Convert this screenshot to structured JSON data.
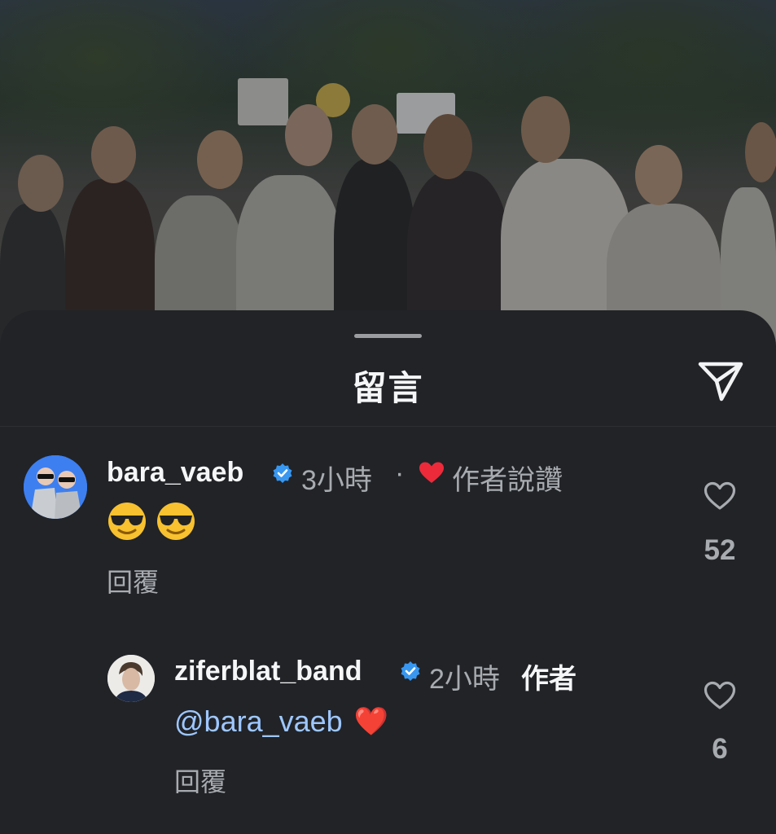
{
  "sheet": {
    "title": "留言",
    "share_icon": "paper-plane-icon"
  },
  "comments": [
    {
      "username": "bara_vaeb",
      "verified": true,
      "time": "3小時",
      "separator": "·",
      "author_liked_label": "作者說讚",
      "text": "😎 😎",
      "reply_label": "回覆",
      "likes": "52"
    },
    {
      "username": "ziferblat_band",
      "verified": true,
      "time": "2小時",
      "author_label": "作者",
      "mention": "@bara_vaeb",
      "text_suffix": "❤️",
      "reply_label": "回覆",
      "likes": "6"
    }
  ],
  "colors": {
    "background": "#212327",
    "verified": "#3897f0",
    "heart": "#ed2a3a",
    "mention": "#9ec7ff",
    "secondary_text": "#a8abb0"
  }
}
